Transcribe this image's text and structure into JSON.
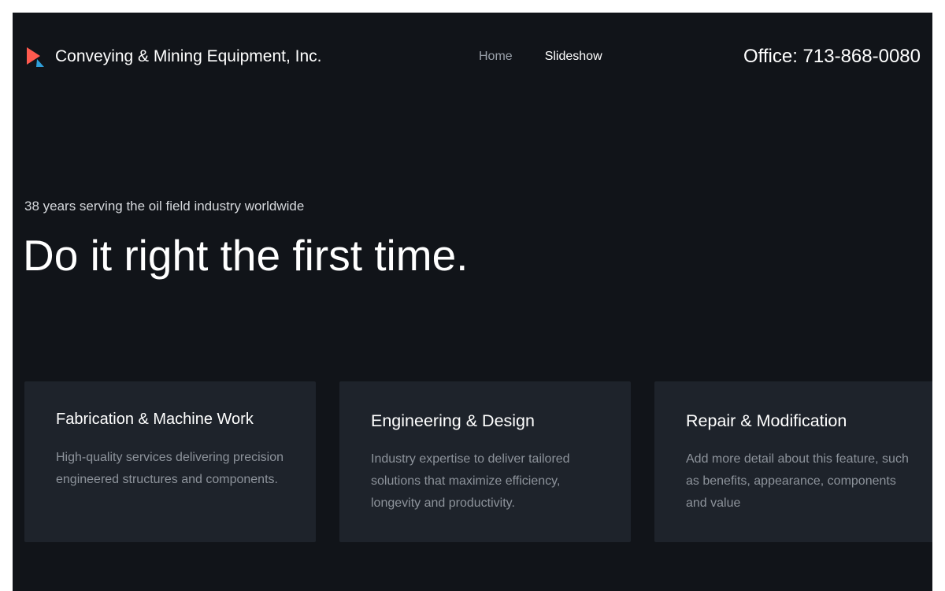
{
  "header": {
    "brand_name": "Conveying & Mining Equipment, Inc.",
    "logo_icon": "play-triangle-logo-icon",
    "nav": [
      {
        "label": "Home"
      },
      {
        "label": "Slideshow"
      }
    ],
    "office_phone": "Office: 713-868-0080"
  },
  "hero": {
    "subtitle": "38 years serving the oil field industry worldwide",
    "title": "Do it right the first time."
  },
  "features": [
    {
      "title": "Fabrication & Machine Work",
      "text": "High-quality services delivering precision engineered structures and components."
    },
    {
      "title": "Engineering & Design",
      "text": "Industry expertise to deliver tailored solutions that maximize efficiency, longevity and productivity."
    },
    {
      "title": "Repair & Modification",
      "text": "Add more detail about this feature, such as benefits, appearance, components and value"
    }
  ],
  "colors": {
    "page_background": "#111419",
    "card_background": "#1e232b",
    "logo_primary": "#ff5a4f",
    "logo_secondary": "#2f9fd9",
    "nav_muted": "#9aa1aa"
  }
}
